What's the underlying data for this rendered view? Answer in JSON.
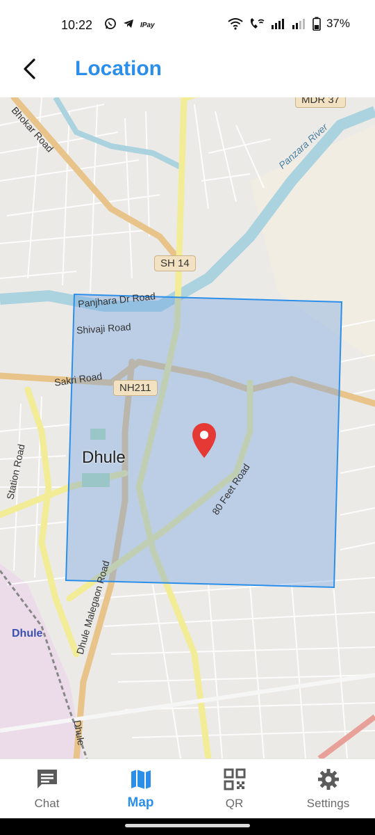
{
  "status_bar": {
    "time": "10:22",
    "battery": "37%",
    "apps": [
      "whatsapp-icon",
      "telegram-icon",
      "ipay-icon"
    ],
    "app_badge_text": "IPay",
    "indicators": [
      "wifi-icon",
      "wifi-call-icon",
      "signal-icon",
      "signal-icon",
      "battery-icon"
    ]
  },
  "header": {
    "title": "Location",
    "back_icon": "back-arrow-icon",
    "accent_color": "#2b8fea"
  },
  "map": {
    "labels": {
      "bhokar_road": "Bhokar Road",
      "mdr37": "MDR 37",
      "panzara_river": "Panzara River",
      "sh14": "SH 14",
      "panjhara_road": "Panjhara Dr Road",
      "shivaji_road": "Shivaji Road",
      "sakri_road": "Sakri Road",
      "nh211": "NH211",
      "city": "Dhule",
      "station_road": "Station Road",
      "feet_road": "80 Feet Road",
      "malegaon_road": "Dhule Malegaon Road",
      "station": "Dhule",
      "dhule_edge": "Dhule"
    },
    "selection_color": "#2b8fea",
    "marker_color": "#e53935",
    "marker_icon": "map-pin-icon"
  },
  "bottom_nav": {
    "items": [
      {
        "label": "Chat",
        "icon": "chat-icon",
        "active": false
      },
      {
        "label": "Map",
        "icon": "map-icon",
        "active": true
      },
      {
        "label": "QR",
        "icon": "qr-icon",
        "active": false
      },
      {
        "label": "Settings",
        "icon": "gear-icon",
        "active": false
      }
    ]
  }
}
